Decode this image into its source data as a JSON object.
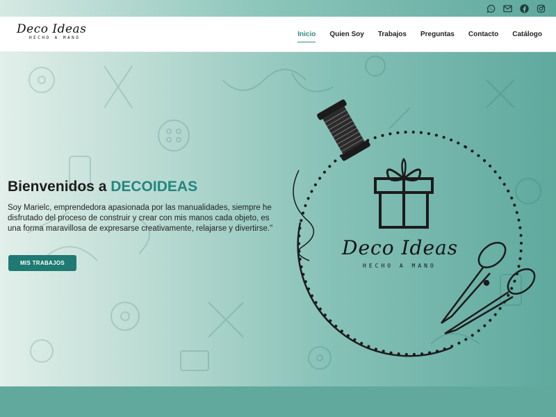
{
  "social": {
    "whatsapp_icon": "whatsapp-icon",
    "mail_icon": "mail-icon",
    "facebook_icon": "facebook-icon",
    "instagram_icon": "instagram-icon"
  },
  "logo": {
    "name": "Deco Ideas",
    "tagline": "HECHO A MANO"
  },
  "nav": {
    "items": [
      {
        "label": "Inicio",
        "active": true
      },
      {
        "label": "Quien Soy"
      },
      {
        "label": "Trabajos"
      },
      {
        "label": "Preguntas"
      },
      {
        "label": "Contacto"
      },
      {
        "label": "Catálogo"
      }
    ]
  },
  "hero": {
    "title_prefix": "Bienvenidos a ",
    "title_brand": "DECOIDEAS",
    "text": "Soy Marielc, emprendedora apasionada por las manualidades, siempre he disfrutado del proceso de construir y crear con mis manos cada objeto, es una forma maravillosa de expresarse creativamente, relajarse y divertirse.\"",
    "cta_label": "MIS TRABAJOS"
  },
  "emblem": {
    "name": "Deco Ideas",
    "tagline": "HECHO A MANO"
  },
  "colors": {
    "accent": "#23867d",
    "button": "#1e7a72",
    "band": "#62a99d"
  }
}
